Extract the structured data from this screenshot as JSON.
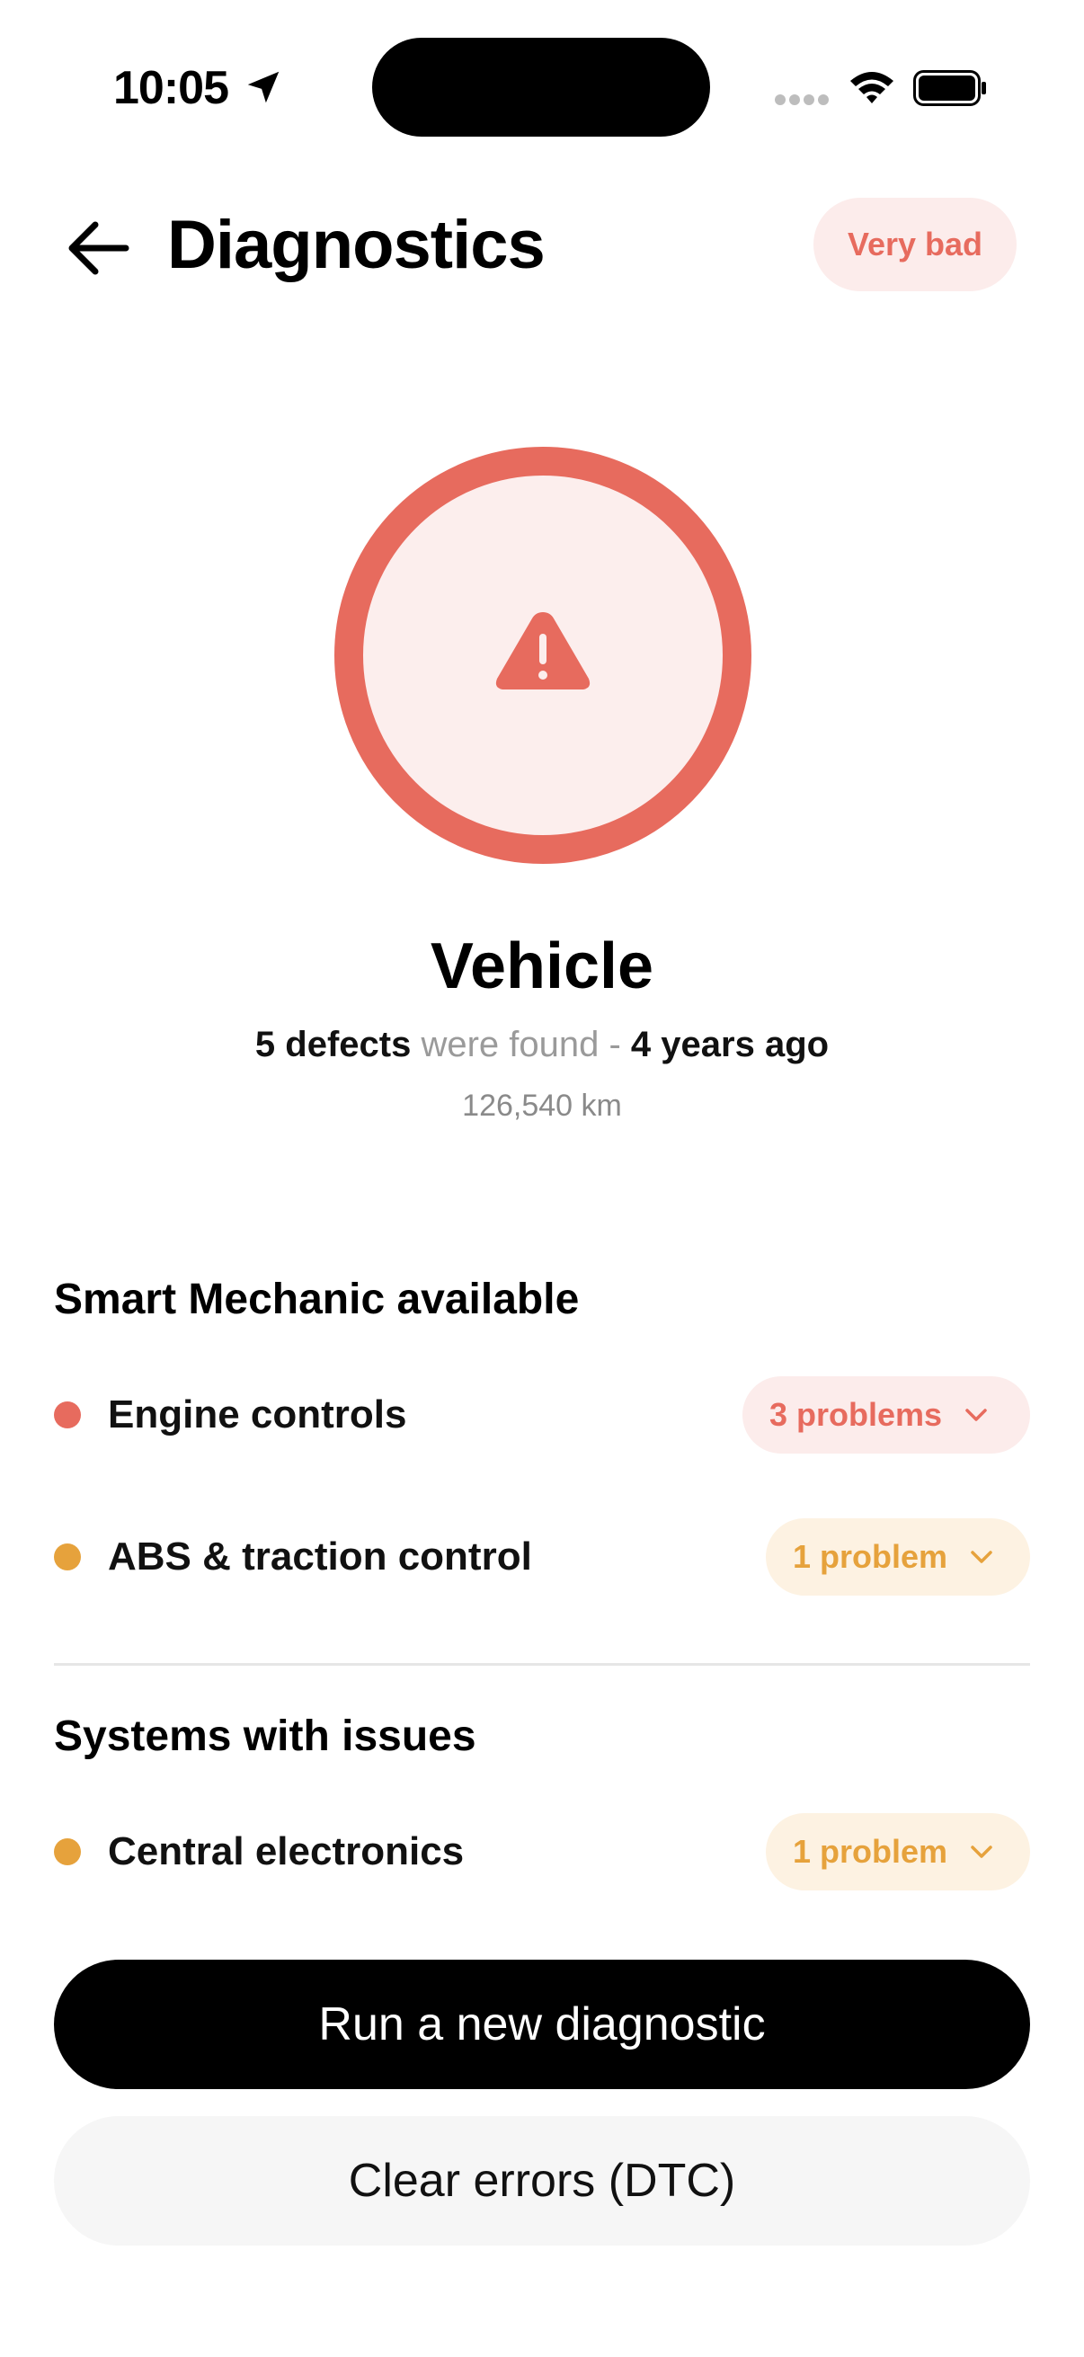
{
  "status_bar": {
    "time": "10:05",
    "location_icon": "location-arrow-icon",
    "signal_icon": "cellular-signal-icon",
    "wifi_icon": "wifi-icon",
    "battery_icon": "battery-icon"
  },
  "header": {
    "back_icon": "arrow-left-icon",
    "title": "Diagnostics",
    "status_badge": "Very bad"
  },
  "summary": {
    "status_icon": "warning-triangle-icon",
    "vehicle": "Vehicle",
    "defects_count": "5 defects",
    "found_text": " were found - ",
    "time_ago": "4 years ago",
    "mileage": "126,540 km"
  },
  "smart_mechanic": {
    "title": "Smart Mechanic available",
    "items": [
      {
        "label": "Engine controls",
        "status": "3 problems",
        "severity": "red"
      },
      {
        "label": "ABS & traction control",
        "status": "1 problem",
        "severity": "orange"
      }
    ]
  },
  "systems_with_issues": {
    "title": "Systems with issues",
    "items": [
      {
        "label": "Central electronics",
        "status": "1 problem",
        "severity": "orange"
      }
    ]
  },
  "actions": {
    "primary": "Run a new diagnostic",
    "secondary": "Clear errors (DTC)"
  },
  "colors": {
    "danger": "#e76b5e",
    "danger_bg": "#fceceb",
    "warning": "#e6a23c",
    "warning_bg": "#fdf2e2",
    "primary_button": "#000000"
  }
}
